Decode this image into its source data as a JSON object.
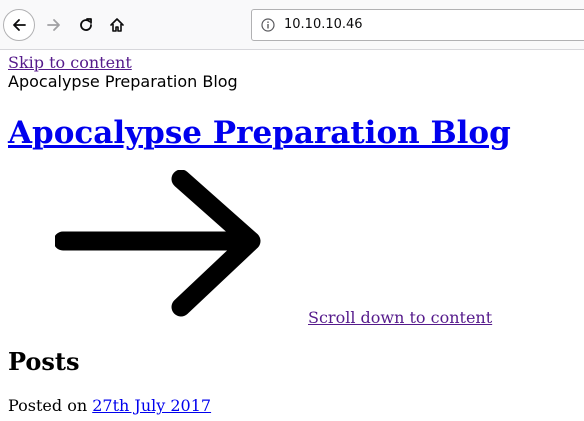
{
  "browser": {
    "url": "10.10.10.46",
    "icons": {
      "back": "back-arrow-icon",
      "forward": "forward-arrow-icon",
      "reload": "reload-icon",
      "home": "home-icon",
      "info": "info-icon"
    }
  },
  "page": {
    "skip_link": "Skip to content",
    "site_description": "Apocalypse Preparation Blog",
    "site_title": "Apocalypse Preparation Blog",
    "scroll_link": "Scroll down to content",
    "posts_heading": "Posts",
    "posted_on_label": "Posted on ",
    "post_date": "27th July 2017"
  },
  "colors": {
    "link": "#0000ee",
    "visited_link": "#551a8b",
    "arrow": "#000000"
  }
}
